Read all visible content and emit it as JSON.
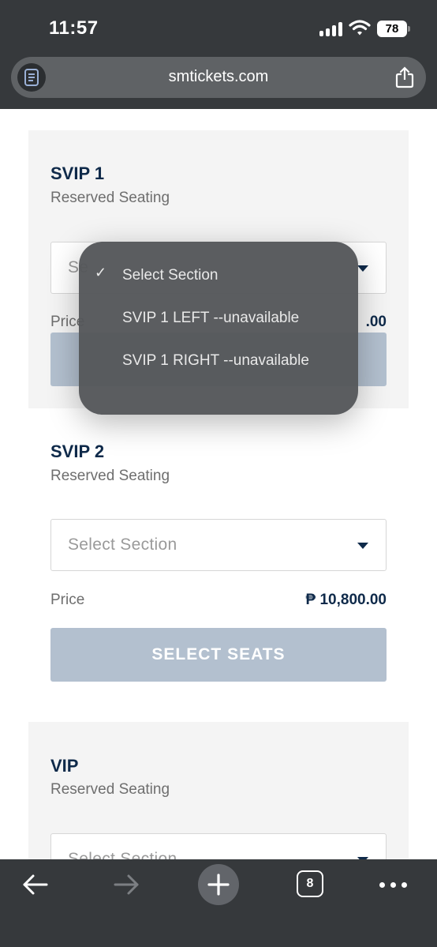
{
  "status_bar": {
    "time": "11:57",
    "battery": "78"
  },
  "browser": {
    "url": "smtickets.com"
  },
  "tiers": [
    {
      "name": "SVIP 1",
      "seating": "Reserved Seating",
      "select_placeholder": "Se",
      "price_label": "Price",
      "price": ".00",
      "button": ""
    },
    {
      "name": "SVIP 2",
      "seating": "Reserved Seating",
      "select_placeholder": "Select Section",
      "price_label": "Price",
      "price": "₱ 10,800.00",
      "button": "SELECT SEATS"
    },
    {
      "name": "VIP",
      "seating": "Reserved Seating",
      "select_placeholder": "Select Section"
    }
  ],
  "dropdown": {
    "options": [
      {
        "label": "Select Section",
        "selected": true
      },
      {
        "label": "SVIP 1 LEFT --unavailable",
        "selected": false
      },
      {
        "label": "SVIP 1 RIGHT --unavailable",
        "selected": false
      }
    ],
    "check_glyph": "✓"
  },
  "toolbar": {
    "tab_count": "8"
  },
  "icons": [
    "reader-icon",
    "share-icon",
    "back-arrow-icon",
    "forward-arrow-icon",
    "plus-icon",
    "tabs-icon",
    "more-icon",
    "wifi-icon",
    "signal-icon",
    "battery-icon"
  ],
  "colors": {
    "navy": "#0f2a4a",
    "button_disabled": "#b3c0cf",
    "card_bg": "#f4f4f4",
    "chrome": "#36393c"
  }
}
